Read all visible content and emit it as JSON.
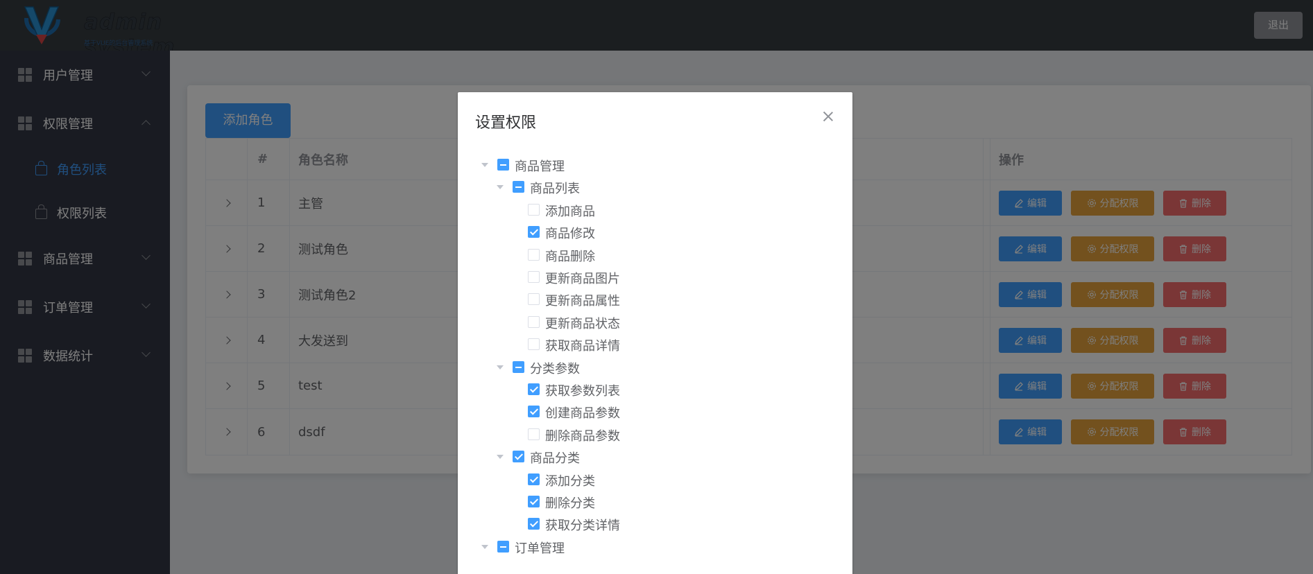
{
  "header": {
    "logo_title": "admin system",
    "logo_subtitle": "基于VUE的后台管理系统",
    "logout_label": "退出"
  },
  "sidebar": {
    "items": [
      {
        "label": "用户管理",
        "expanded": false
      },
      {
        "label": "权限管理",
        "expanded": true,
        "children": [
          {
            "label": "角色列表",
            "active": true
          },
          {
            "label": "权限列表",
            "active": false
          }
        ]
      },
      {
        "label": "商品管理",
        "expanded": false
      },
      {
        "label": "订单管理",
        "expanded": false
      },
      {
        "label": "数据统计",
        "expanded": false
      }
    ]
  },
  "main": {
    "add_role_label": "添加角色",
    "table": {
      "columns": [
        "",
        "#",
        "角色名称",
        "操作"
      ],
      "rows": [
        {
          "index": "1",
          "name": "主管"
        },
        {
          "index": "2",
          "name": "测试角色"
        },
        {
          "index": "3",
          "name": "测试角色2"
        },
        {
          "index": "4",
          "name": "大发送到"
        },
        {
          "index": "5",
          "name": "test"
        },
        {
          "index": "6",
          "name": "dsdf"
        }
      ],
      "actions": {
        "edit": "编辑",
        "assign": "分配权限",
        "delete": "删除"
      }
    }
  },
  "dialog": {
    "title": "设置权限",
    "tree": [
      {
        "level": 0,
        "label": "商品管理",
        "state": "indeterminate"
      },
      {
        "level": 1,
        "label": "商品列表",
        "state": "indeterminate"
      },
      {
        "level": 2,
        "label": "添加商品",
        "state": "unchecked"
      },
      {
        "level": 2,
        "label": "商品修改",
        "state": "checked"
      },
      {
        "level": 2,
        "label": "商品删除",
        "state": "unchecked"
      },
      {
        "level": 2,
        "label": "更新商品图片",
        "state": "unchecked"
      },
      {
        "level": 2,
        "label": "更新商品属性",
        "state": "unchecked"
      },
      {
        "level": 2,
        "label": "更新商品状态",
        "state": "unchecked"
      },
      {
        "level": 2,
        "label": "获取商品详情",
        "state": "unchecked"
      },
      {
        "level": 1,
        "label": "分类参数",
        "state": "indeterminate"
      },
      {
        "level": 2,
        "label": "获取参数列表",
        "state": "checked"
      },
      {
        "level": 2,
        "label": "创建商品参数",
        "state": "checked"
      },
      {
        "level": 2,
        "label": "删除商品参数",
        "state": "unchecked"
      },
      {
        "level": 1,
        "label": "商品分类",
        "state": "checked"
      },
      {
        "level": 2,
        "label": "添加分类",
        "state": "checked"
      },
      {
        "level": 2,
        "label": "删除分类",
        "state": "checked"
      },
      {
        "level": 2,
        "label": "获取分类详情",
        "state": "checked"
      },
      {
        "level": 0,
        "label": "订单管理",
        "state": "indeterminate"
      }
    ]
  },
  "colors": {
    "primary": "#409eff",
    "warning": "#e6a23c",
    "danger": "#f56c6c",
    "header_bg": "#373d41",
    "sidebar_bg": "#333744"
  }
}
